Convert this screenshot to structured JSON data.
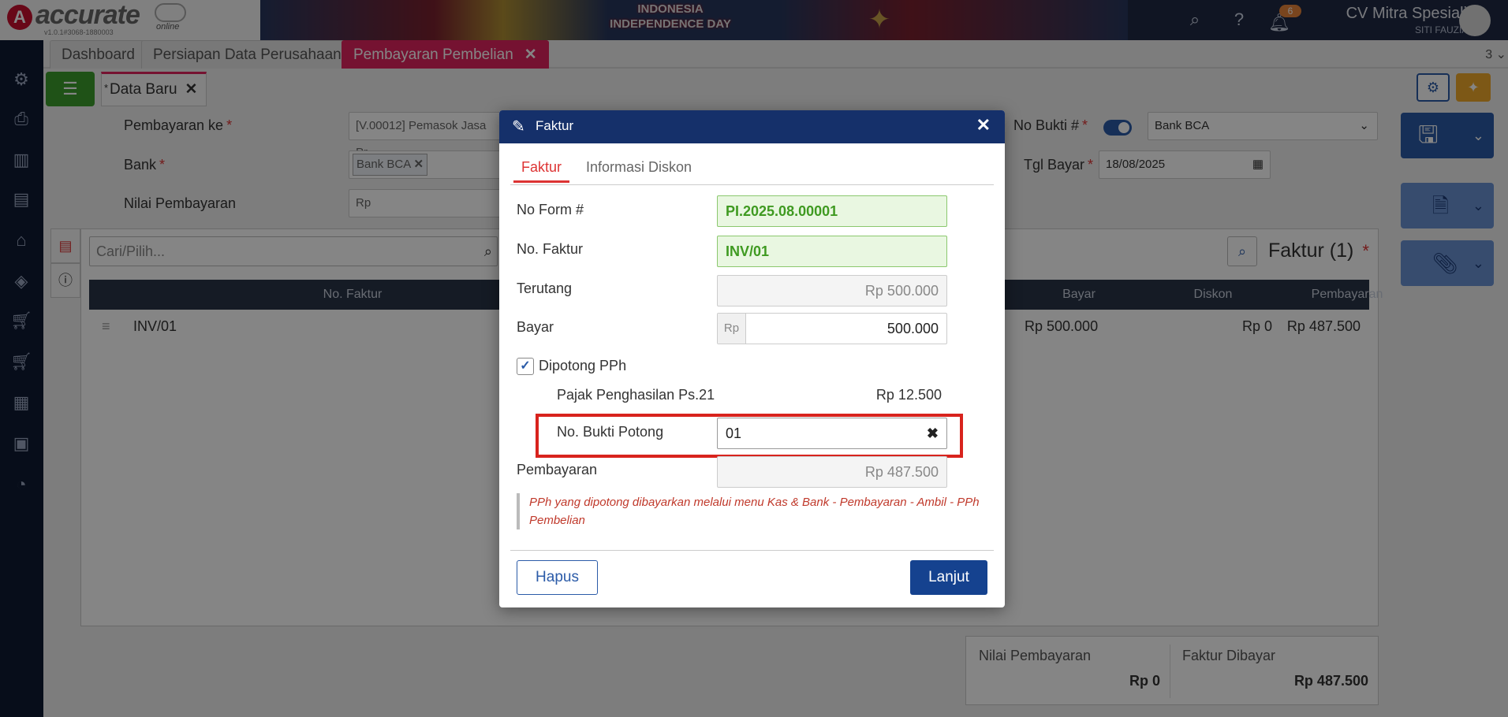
{
  "app": {
    "logo_text": "accurate",
    "logo_sub": "online",
    "version": "v1.0.1#3068-1880003",
    "banner_text": "INDONESIA INDEPENDENCE DAY",
    "notification_count": "6",
    "company": "CV Mitra Spesialis",
    "user": "SITI FAUZIAH"
  },
  "tabs": [
    {
      "label": "Dashboard"
    },
    {
      "label": "Persiapan Data Perusahaan"
    },
    {
      "label": "Pembayaran Pembelian"
    }
  ],
  "tab_count": "3",
  "subtab": {
    "label": "Data Baru",
    "star": "*"
  },
  "form": {
    "pembayaran_ke_label": "Pembayaran ke",
    "pembayaran_ke_value": "[V.00012] Pemasok Jasa Pr",
    "bank_label": "Bank",
    "bank_chip": "Bank BCA",
    "nilai_label": "Nilai Pembayaran",
    "nilai_prefix": "Rp",
    "no_bukti_label": "No Bukti #",
    "no_bukti_value": "Bank BCA",
    "tgl_label": "Tgl Bayar",
    "tgl_value": "18/08/2025",
    "required_mark": "*"
  },
  "grid": {
    "search_placeholder": "Cari/Pilih...",
    "title": "Faktur (1)",
    "columns": [
      "No. Faktur",
      "Bayar",
      "Diskon",
      "Pembayaran"
    ],
    "row": {
      "no_faktur": "INV/01",
      "bayar": "Rp 500.000",
      "diskon": "Rp 0",
      "pembayaran": "Rp 487.500"
    }
  },
  "summary": {
    "nilai_label": "Nilai Pembayaran",
    "nilai_value": "Rp 0",
    "faktur_label": "Faktur Dibayar",
    "faktur_value": "Rp 487.500"
  },
  "modal": {
    "title": "Faktur",
    "tabs": [
      "Faktur",
      "Informasi Diskon"
    ],
    "no_form_label": "No Form #",
    "no_form_value": "PI.2025.08.00001",
    "no_faktur_label": "No. Faktur",
    "no_faktur_value": "INV/01",
    "terutang_label": "Terutang",
    "terutang_value": "Rp 500.000",
    "bayar_label": "Bayar",
    "bayar_prefix": "Rp",
    "bayar_value": "500.000",
    "dipotong_label": "Dipotong PPh",
    "pajak_label": "Pajak Penghasilan Ps.21",
    "pajak_value": "Rp 12.500",
    "bukti_potong_label": "No. Bukti Potong",
    "bukti_potong_value": "01",
    "pembayaran_label": "Pembayaran",
    "pembayaran_value": "Rp 487.500",
    "note": "PPh yang dipotong dibayarkan melalui menu Kas & Bank - Pembayaran - Ambil - PPh Pembelian",
    "hapus_label": "Hapus",
    "lanjut_label": "Lanjut"
  }
}
